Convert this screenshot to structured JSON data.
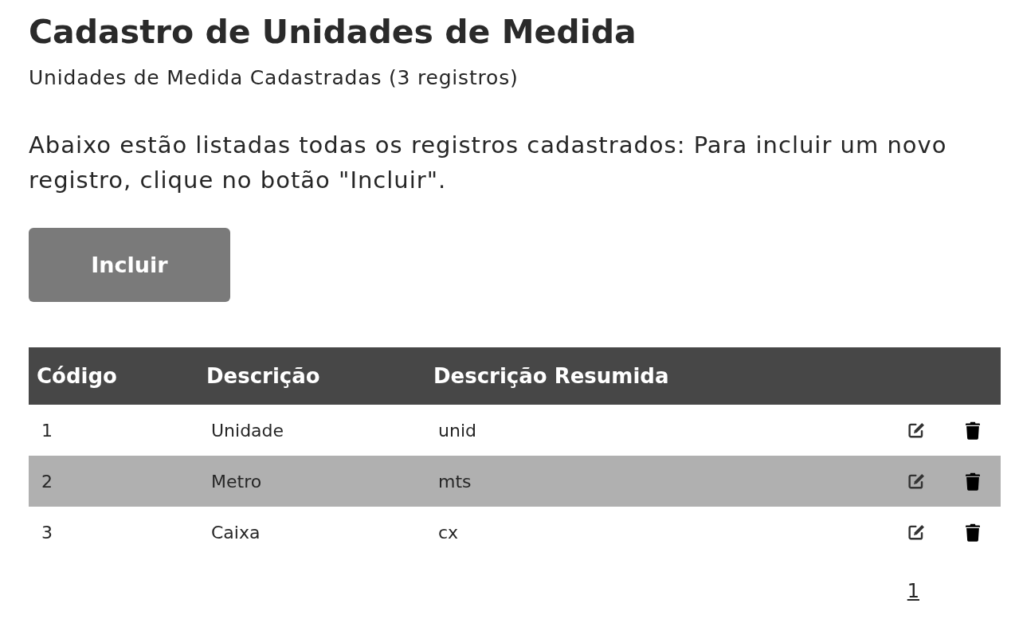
{
  "page": {
    "title": "Cadastro de Unidades de Medida",
    "subtitle": "Unidades de Medida Cadastradas (3 registros)",
    "description": "Abaixo estão listadas todas os registros cadastrados: Para incluir um novo registro, clique no botão \"Incluir\"."
  },
  "add_button": {
    "label": "Incluir"
  },
  "table": {
    "columns": [
      "Código",
      "Descrição",
      "Descrição Resumida"
    ],
    "rows": [
      {
        "code": "1",
        "description": "Unidade",
        "short_description": "unid",
        "highlighted": false
      },
      {
        "code": "2",
        "description": "Metro",
        "short_description": "mts",
        "highlighted": true
      },
      {
        "code": "3",
        "description": "Caixa",
        "short_description": "cx",
        "highlighted": false
      }
    ]
  },
  "pagination": {
    "pages": [
      "1"
    ]
  }
}
